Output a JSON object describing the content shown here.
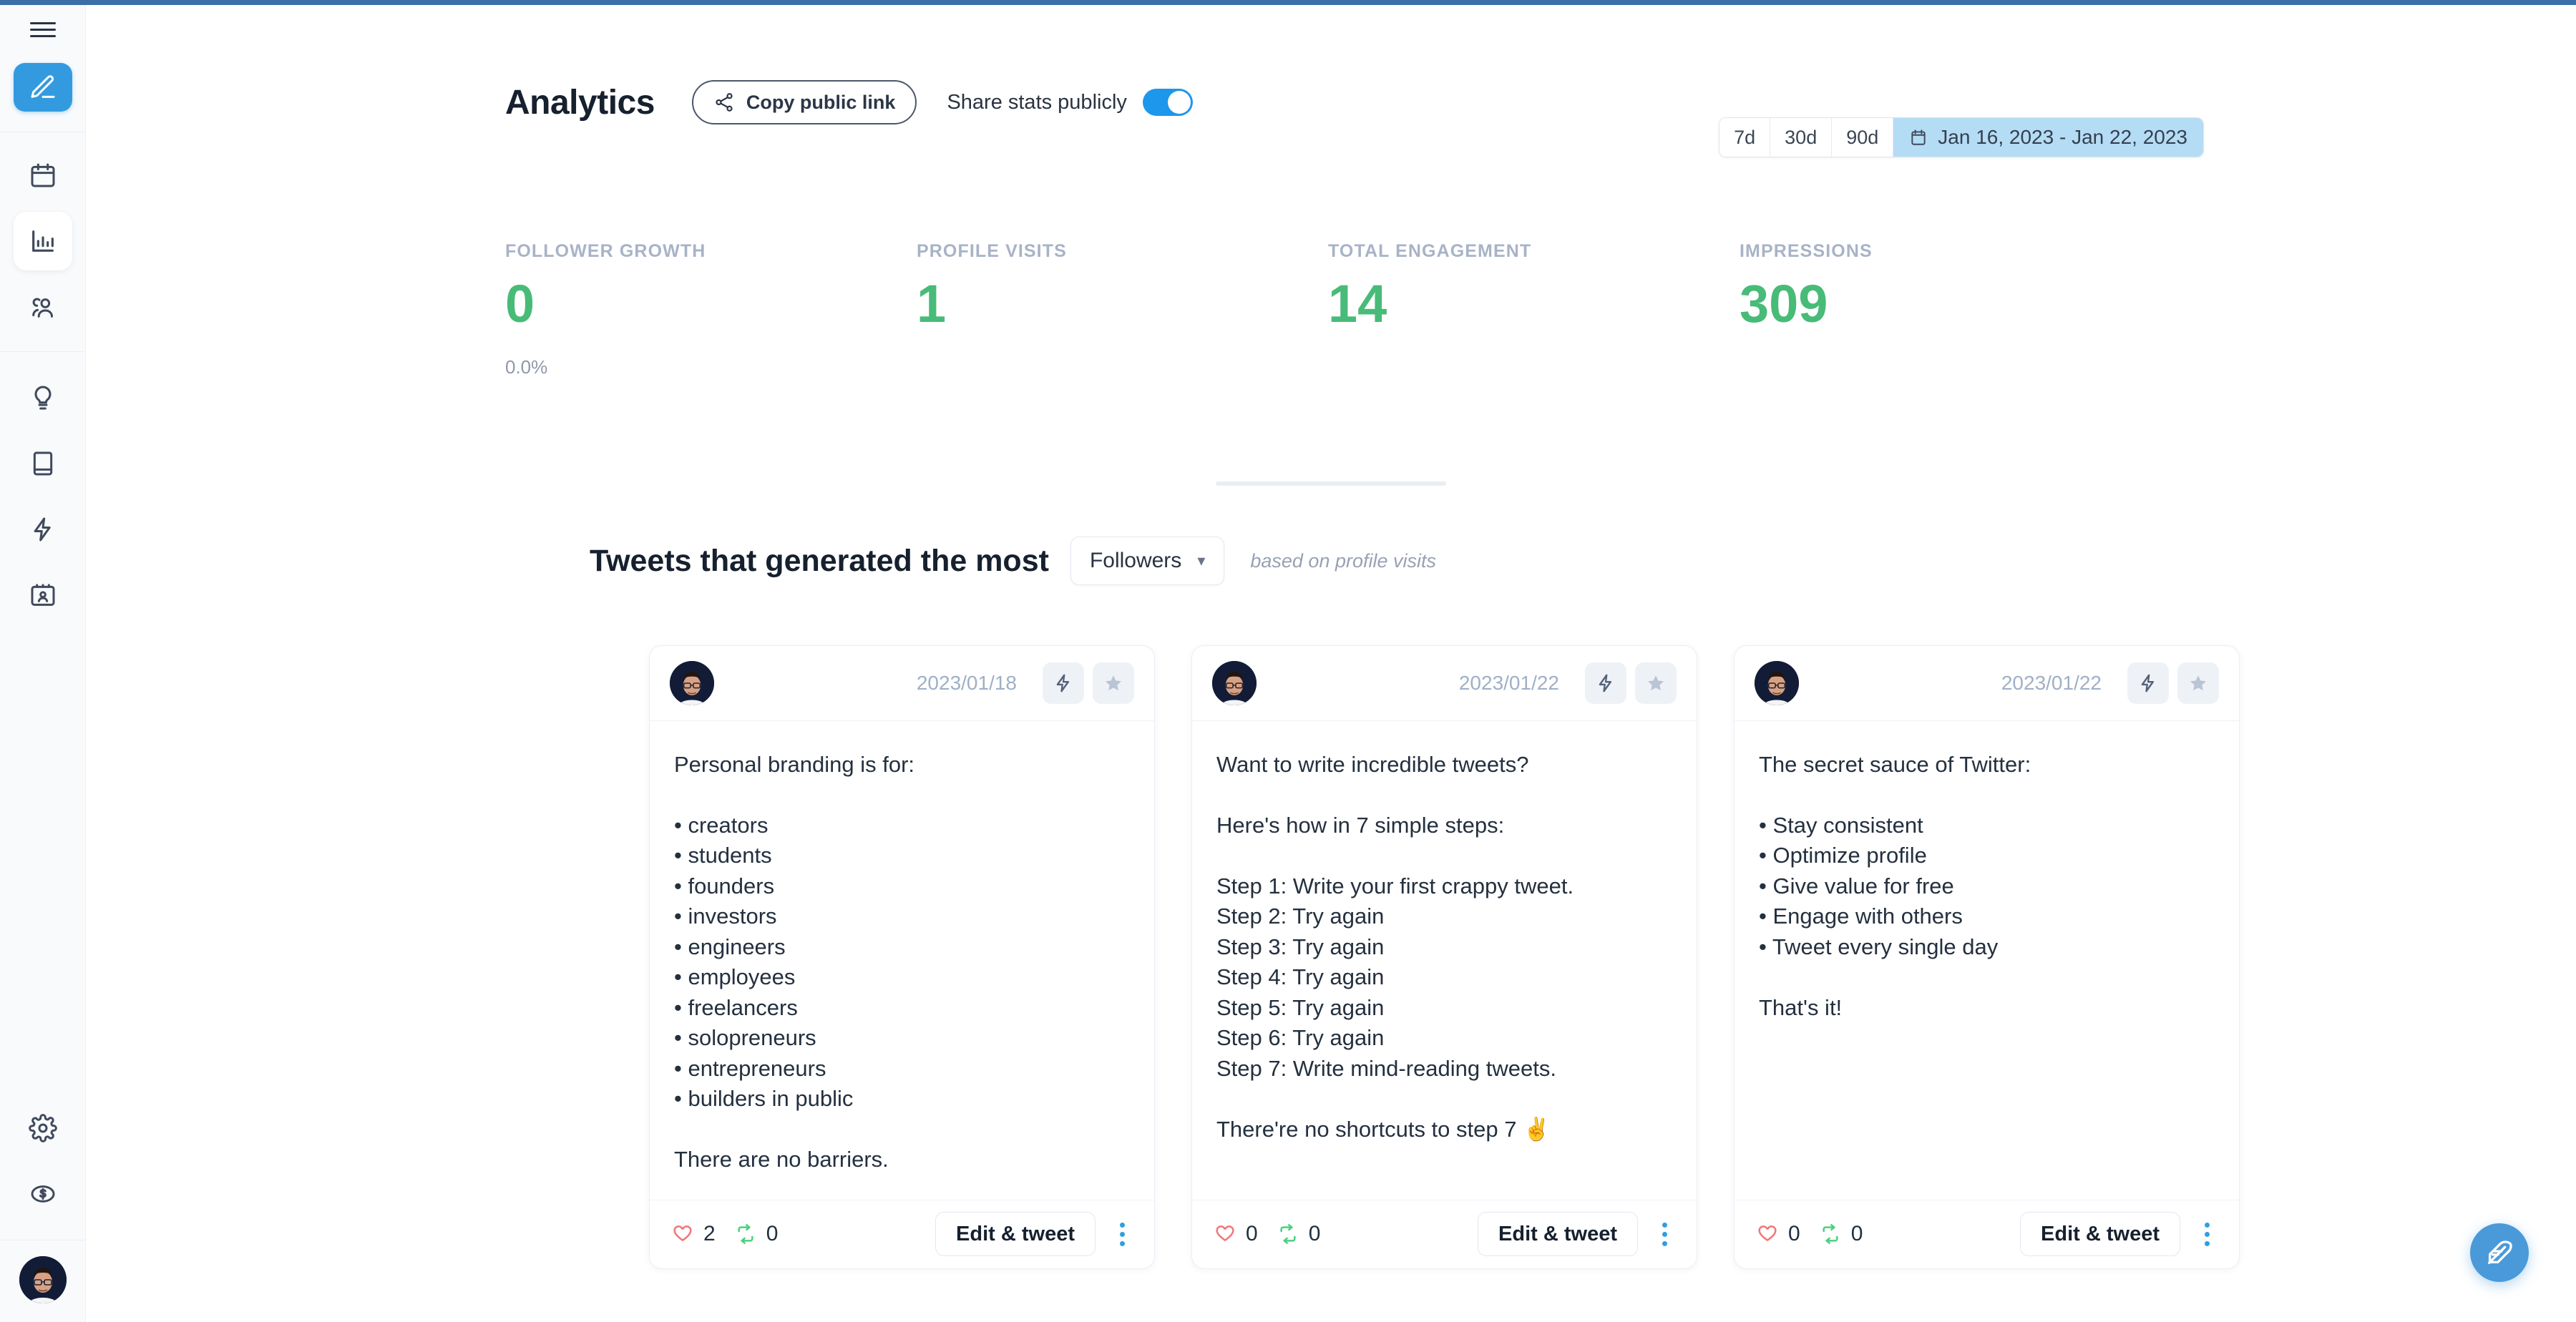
{
  "sidebar": {
    "menu_icon": "hamburger-icon",
    "compose_icon": "pencil-icon",
    "items": [
      {
        "icon": "calendar-icon",
        "name": "calendar",
        "active": false
      },
      {
        "icon": "bar-chart-icon",
        "name": "analytics",
        "active": true
      },
      {
        "icon": "users-icon",
        "name": "audience",
        "active": false
      },
      {
        "icon": "lightbulb-icon",
        "name": "ideas",
        "active": false
      },
      {
        "icon": "book-icon",
        "name": "library",
        "active": false
      },
      {
        "icon": "lightning-icon",
        "name": "automation",
        "active": false
      },
      {
        "icon": "id-card-icon",
        "name": "profile-card",
        "active": false
      },
      {
        "icon": "gear-icon",
        "name": "settings",
        "active": false
      },
      {
        "icon": "dollar-circle-icon",
        "name": "billing",
        "active": false
      }
    ],
    "avatar_alt": "user-avatar"
  },
  "header": {
    "title": "Analytics",
    "copy_link_label": "Copy public link",
    "share_icon": "share-icon",
    "share_label": "Share stats publicly",
    "share_toggle_on": true
  },
  "range": {
    "options": [
      "7d",
      "30d",
      "90d"
    ],
    "calendar_icon": "calendar-icon",
    "date_label": "Jan 16, 2023 - Jan 22, 2023",
    "selected": "custom"
  },
  "stats": [
    {
      "label": "FOLLOWER GROWTH",
      "value": "0",
      "sub": "0.0%"
    },
    {
      "label": "PROFILE VISITS",
      "value": "1",
      "sub": ""
    },
    {
      "label": "TOTAL ENGAGEMENT",
      "value": "14",
      "sub": ""
    },
    {
      "label": "IMPRESSIONS",
      "value": "309",
      "sub": ""
    }
  ],
  "section": {
    "title": "Tweets that generated the most",
    "dropdown_value": "Followers",
    "note": "based on profile visits"
  },
  "cards": [
    {
      "date": "2023/01/18",
      "boost_icon": "lightning-icon",
      "star_icon": "star-icon",
      "text": "Personal branding is for:\n\n• creators\n• students\n• founders\n• investors\n• engineers\n• employees\n• freelancers\n• solopreneurs\n• entrepreneurs\n• builders in public\n\nThere are no barriers.",
      "likes": "2",
      "retweets": "0",
      "edit_label": "Edit & tweet",
      "menu_icon": "kebab-menu-icon"
    },
    {
      "date": "2023/01/22",
      "boost_icon": "lightning-icon",
      "star_icon": "star-icon",
      "text": "Want to write incredible tweets?\n\nHere's how in 7 simple steps:\n\nStep 1: Write your first crappy tweet.\nStep 2: Try again\nStep 3: Try again\nStep 4: Try again\nStep 5: Try again\nStep 6: Try again\nStep 7: Write mind-reading tweets.\n\nThere're no shortcuts to step 7 ✌️",
      "likes": "0",
      "retweets": "0",
      "edit_label": "Edit & tweet",
      "menu_icon": "kebab-menu-icon"
    },
    {
      "date": "2023/01/22",
      "boost_icon": "lightning-icon",
      "star_icon": "star-icon",
      "text": "The secret sauce of Twitter:\n\n• Stay consistent\n• Optimize profile\n• Give value for free\n• Engage with others\n• Tweet every single day\n\nThat's it!",
      "likes": "0",
      "retweets": "0",
      "edit_label": "Edit & tweet",
      "menu_icon": "kebab-menu-icon"
    }
  ],
  "fab": {
    "icon": "feather-icon"
  },
  "colors": {
    "accent": "#349ae0",
    "stat_value": "#48bb78",
    "date_pill": "#b5dcf5",
    "heart": "#f2777a",
    "retweet": "#4bd07f",
    "topbar": "#3c6fa8"
  }
}
